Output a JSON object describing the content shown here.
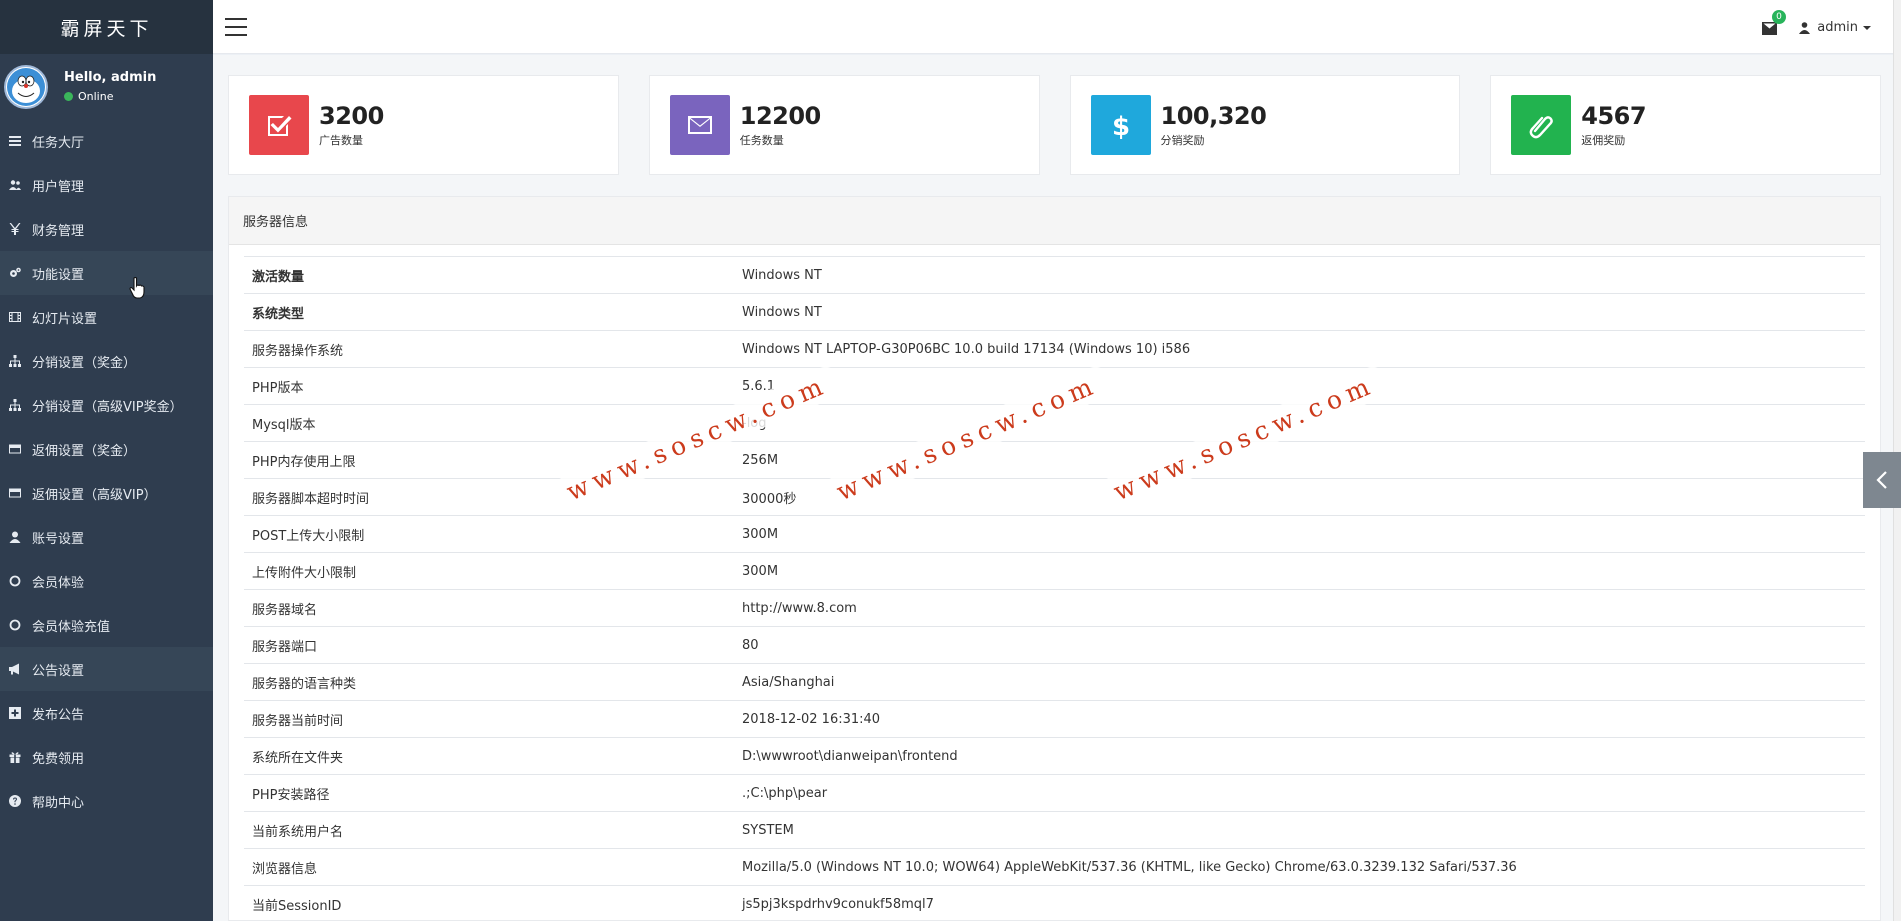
{
  "brand": "霸屏天下",
  "user": {
    "greeting": "Hello, admin",
    "status": "Online"
  },
  "menu": [
    {
      "label": "任务大厅",
      "icon": "list-icon"
    },
    {
      "label": "用户管理",
      "icon": "users-icon"
    },
    {
      "label": "财务管理",
      "icon": "yen-icon"
    },
    {
      "label": "功能设置",
      "icon": "cogs-icon"
    },
    {
      "label": "幻灯片设置",
      "icon": "film-icon"
    },
    {
      "label": "分销设置（奖金）",
      "icon": "sitemap-icon"
    },
    {
      "label": "分销设置（高级VIP奖金）",
      "icon": "sitemap-icon"
    },
    {
      "label": "返佣设置（奖金）",
      "icon": "credit-card-icon"
    },
    {
      "label": "返佣设置（高级VIP）",
      "icon": "credit-card-icon"
    },
    {
      "label": "账号设置",
      "icon": "user-icon"
    },
    {
      "label": "会员体验",
      "icon": "circle-icon"
    },
    {
      "label": "会员体验充值",
      "icon": "circle-icon"
    },
    {
      "label": "公告设置",
      "icon": "bullhorn-icon"
    },
    {
      "label": "发布公告",
      "icon": "plus-square-icon"
    },
    {
      "label": "免费领用",
      "icon": "gift-icon"
    },
    {
      "label": "帮助中心",
      "icon": "question-icon"
    }
  ],
  "topbar": {
    "mail_count": "0",
    "admin_label": "admin"
  },
  "stats": [
    {
      "value": "3200",
      "label": "广告数量",
      "color": "#e8474c",
      "icon": "check-square-icon"
    },
    {
      "value": "12200",
      "label": "任务数量",
      "color": "#7a64be",
      "icon": "envelope-icon"
    },
    {
      "value": "100,320",
      "label": "分销奖励",
      "color": "#1fa8dc",
      "icon": "dollar-icon"
    },
    {
      "value": "4567",
      "label": "返佣奖励",
      "color": "#22b34f",
      "icon": "paperclip-icon"
    }
  ],
  "panel": {
    "title": "服务器信息"
  },
  "server_info": [
    {
      "key": "激活数量",
      "value": "Windows NT"
    },
    {
      "key": "系统类型",
      "value": "Windows NT"
    },
    {
      "key": "服务器操作系统",
      "value": "Windows NT LAPTOP-G30P06BC 10.0 build 17134 (Windows 10) i586"
    },
    {
      "key": "PHP版本",
      "value": "5.6.1"
    },
    {
      "key": "Mysql版本",
      "value": "-log"
    },
    {
      "key": "PHP内存使用上限",
      "value": "256M"
    },
    {
      "key": "服务器脚本超时时间",
      "value": "30000秒"
    },
    {
      "key": "POST上传大小限制",
      "value": "300M"
    },
    {
      "key": "上传附件大小限制",
      "value": "300M"
    },
    {
      "key": "服务器域名",
      "value": "http://www.8.com"
    },
    {
      "key": "服务器端口",
      "value": "80"
    },
    {
      "key": "服务器的语言种类",
      "value": "Asia/Shanghai"
    },
    {
      "key": "服务器当前时间",
      "value": "2018-12-02 16:31:40"
    },
    {
      "key": "系统所在文件夹",
      "value": "D:\\wwwroot\\dianweipan\\frontend"
    },
    {
      "key": "PHP安装路径",
      "value": ".;C:\\php\\pear"
    },
    {
      "key": "当前系统用户名",
      "value": "SYSTEM"
    },
    {
      "key": "浏览器信息",
      "value": "Mozilla/5.0 (Windows NT 10.0; WOW64) AppleWebKit/537.36 (KHTML, like Gecko) Chrome/63.0.3239.132 Safari/537.36"
    },
    {
      "key": "当前SessionID",
      "value": "js5pj3kspdrhv9conukf58mql7"
    }
  ],
  "watermark": "www.soscw.com"
}
